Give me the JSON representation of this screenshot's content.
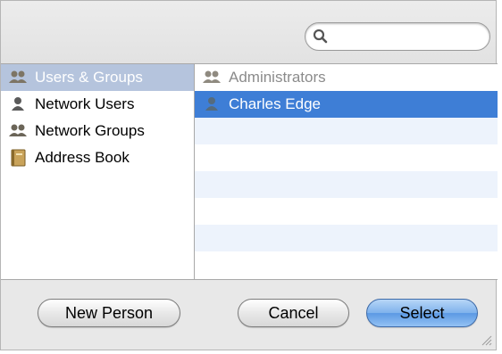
{
  "search": {
    "value": "",
    "placeholder": "",
    "icon": "search-icon"
  },
  "sources": [
    {
      "label": "Users & Groups",
      "icon": "group-icon",
      "selected": true
    },
    {
      "label": "Network Users",
      "icon": "user-icon",
      "selected": false
    },
    {
      "label": "Network Groups",
      "icon": "group-icon",
      "selected": false
    },
    {
      "label": "Address Book",
      "icon": "address-book-icon",
      "selected": false
    }
  ],
  "entries": [
    {
      "label": "Administrators",
      "icon": "group-icon",
      "disabled": true
    },
    {
      "label": "Charles Edge",
      "icon": "user-icon",
      "selected": true
    }
  ],
  "buttons": {
    "new_person": "New Person",
    "cancel": "Cancel",
    "select": "Select"
  },
  "colors": {
    "selection": "#3e7ed6",
    "inactive_selection": "#b5c4dd",
    "stripe": "#edf3fc"
  }
}
